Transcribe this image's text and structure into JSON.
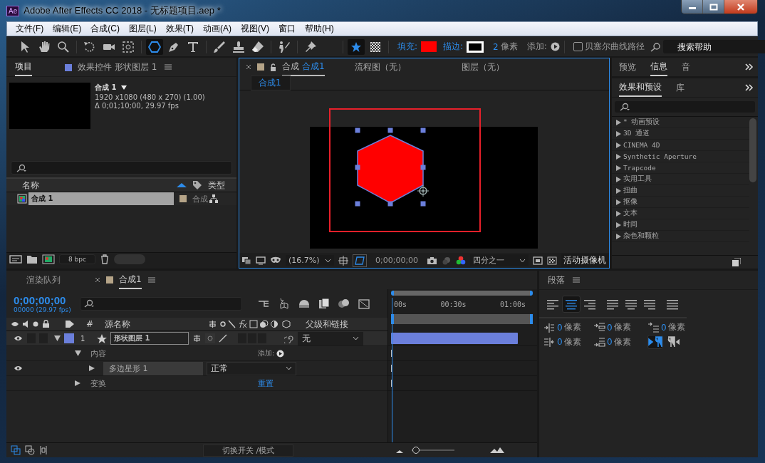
{
  "window": {
    "app_badge": "Ae",
    "title": "Adobe After Effects CC 2018 - 无标题项目.aep *"
  },
  "menu": [
    "文件(F)",
    "编辑(E)",
    "合成(C)",
    "图层(L)",
    "效果(T)",
    "动画(A)",
    "视图(V)",
    "窗口",
    "帮助(H)"
  ],
  "toolbar": {
    "tools": [
      {
        "kind": "select",
        "selected": false
      },
      {
        "kind": "hand",
        "selected": false
      },
      {
        "kind": "zoom",
        "selected": false
      },
      {
        "kind": "rotate",
        "selected": false
      },
      {
        "kind": "camera",
        "selected": false
      },
      {
        "kind": "pan",
        "selected": false
      },
      {
        "kind": "shape",
        "selected": true
      },
      {
        "kind": "pen",
        "selected": false
      },
      {
        "kind": "text",
        "selected": false
      },
      {
        "kind": "brush",
        "selected": false
      },
      {
        "kind": "stamp",
        "selected": false
      },
      {
        "kind": "eraser",
        "selected": false
      },
      {
        "kind": "roto",
        "selected": false
      },
      {
        "kind": "puppet",
        "selected": false
      }
    ],
    "fill": {
      "label": "填充:",
      "color": "#ff0000"
    },
    "stroke": {
      "label": "描边:"
    },
    "stroke_width": {
      "value": "2",
      "unit": "像素"
    },
    "add_label": "添加:",
    "bezier": {
      "label": "贝塞尔曲线路径",
      "checked": false
    },
    "search": {
      "placeholder": "搜索帮助"
    }
  },
  "project": {
    "tabs": [
      {
        "label": "项目",
        "selected": true
      },
      {
        "label": "效果控件 形状图层 1",
        "selected": false
      }
    ],
    "info": {
      "name": "合成 1",
      "size": "1920 x1080  (480 x 270) (1.00)",
      "duration": "Δ 0;01;10;00, 29.97 fps"
    },
    "columns": [
      "名称",
      "类型"
    ],
    "items": [
      {
        "name": "合成 1",
        "type": "合成",
        "selected": true,
        "color": "#b5a488"
      }
    ],
    "bpc": "8 bpc"
  },
  "viewer": {
    "tabs": [
      {
        "prefix": "合成",
        "name": "合成1",
        "selected": true
      },
      {
        "prefix": "流程图（无）",
        "selected": false
      },
      {
        "prefix": "图层（无）",
        "selected": false
      }
    ],
    "subtab": "合成1",
    "zoom": "(16.7%)",
    "time": "0;00;00;00",
    "resolution": "四分之一",
    "camera": "活动摄像机"
  },
  "side": {
    "tabs": [
      {
        "label": "预览",
        "selected": false
      },
      {
        "label": "信息",
        "selected": true
      },
      {
        "label": "音",
        "selected": false
      }
    ],
    "panel_tabs": [
      {
        "label": "效果和预设",
        "selected": true
      },
      {
        "label": "库",
        "selected": false
      }
    ],
    "effects": [
      "* 动画预设",
      "3D 通道",
      "CINEMA 4D",
      "Synthetic Aperture",
      "Trapcode",
      "实用工具",
      "扭曲",
      "抠像",
      "文本",
      "时间",
      "杂色和颗粒"
    ]
  },
  "timeline": {
    "tabs": [
      {
        "label": "渲染队列",
        "selected": false
      },
      {
        "label": "合成1",
        "selected": true
      }
    ],
    "timecode": "0;00;00;00",
    "frames": "00000 (29.97 fps)",
    "columns": {
      "number": "#",
      "source": "源名称",
      "parent": "父级和链接"
    },
    "ruler": [
      "00s",
      "00:30s",
      "01:00s"
    ],
    "layers": [
      {
        "number": "1",
        "name": "形状图层 1",
        "color": "#6b7fdb",
        "expanded": true,
        "visible": true,
        "parent": "无",
        "children": [
          {
            "kind": "group",
            "name": "内容",
            "expanded": true,
            "action": "添加:"
          },
          {
            "kind": "shape",
            "name": "多边星形 1",
            "expanded": false,
            "visible": true,
            "mode": "正常"
          },
          {
            "kind": "group",
            "name": "变换",
            "expanded": false,
            "action": "重置"
          }
        ]
      }
    ],
    "footer": "切换开关 /模式",
    "zoom_slider": {
      "level": 0.02
    }
  },
  "paragraph": {
    "title": "段落",
    "align": [
      {
        "kind": "left",
        "selected": false
      },
      {
        "kind": "center",
        "selected": true
      },
      {
        "kind": "right",
        "selected": false
      },
      {
        "kind": "justify_left",
        "selected": false
      },
      {
        "kind": "justify_center",
        "selected": false
      },
      {
        "kind": "justify_right",
        "selected": false
      },
      {
        "kind": "justify_all",
        "selected": false
      }
    ],
    "fields": [
      {
        "kind": "indent_left",
        "value": "0",
        "unit": "像素"
      },
      {
        "kind": "space_before",
        "value": "0",
        "unit": "像素"
      },
      {
        "kind": "first_line",
        "value": "0",
        "unit": "像素"
      },
      {
        "kind": "indent_right",
        "value": "0",
        "unit": "像素"
      },
      {
        "kind": "space_after",
        "value": "0",
        "unit": "像素"
      }
    ],
    "direction": [
      {
        "kind": "ltr",
        "selected": true
      },
      {
        "kind": "rtl",
        "selected": false
      }
    ]
  }
}
